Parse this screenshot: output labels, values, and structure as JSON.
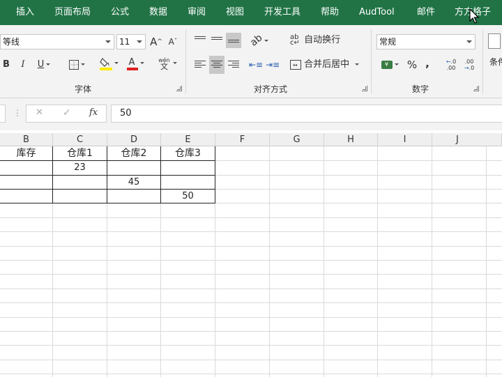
{
  "ribbon_tabs": [
    "插入",
    "页面布局",
    "公式",
    "数据",
    "审阅",
    "视图",
    "开发工具",
    "帮助",
    "AudTool",
    "邮件",
    "方方格子"
  ],
  "font_group": {
    "font_name": "等线",
    "font_size": "11",
    "bold": "B",
    "italic": "I",
    "underline": "U",
    "font_color_glyph": "A",
    "phonetic_top": "wén",
    "phonetic_bottom": "文",
    "grow_font": "A",
    "shrink_font": "A",
    "label": "字体"
  },
  "alignment_group": {
    "wrap_text": "自动换行",
    "merge_center": "合并后居中",
    "label": "对齐方式"
  },
  "number_group": {
    "format": "常规",
    "percent": "%",
    "comma": ",",
    "inc_decimal": "←.0 .00",
    "dec_decimal": ".00 →.0",
    "label": "数字"
  },
  "styles_group": {
    "conditional": "条件"
  },
  "formula_bar": {
    "cancel": "✕",
    "enter": "✓",
    "fx": "fx",
    "value": "50"
  },
  "columns": [
    "B",
    "C",
    "D",
    "E",
    "F",
    "G",
    "H",
    "I",
    "J"
  ],
  "table": {
    "headers": [
      "库存",
      "仓库1",
      "仓库2",
      "仓库3"
    ],
    "rows": [
      [
        "",
        "23",
        "",
        ""
      ],
      [
        "",
        "",
        "45",
        ""
      ],
      [
        "",
        "",
        "",
        "50"
      ]
    ]
  },
  "colors": {
    "ribbon_green": "#217346",
    "underline_red": "#e02020",
    "fill_yellow": "#ffeb00"
  }
}
